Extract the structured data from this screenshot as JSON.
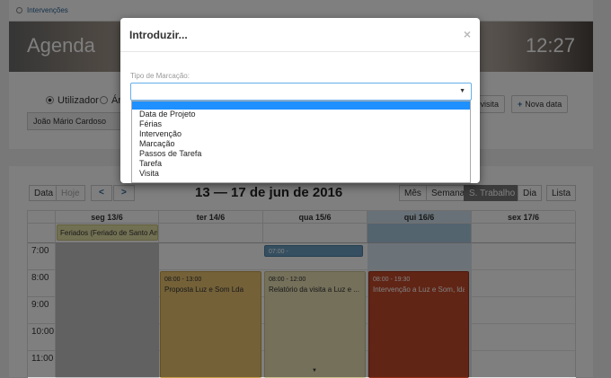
{
  "breadcrumb": {
    "label": "Intervenções"
  },
  "banner": {
    "title": "Agenda",
    "clock": "12:27"
  },
  "filter": {
    "radio_user": "Utilizador",
    "radio_area": "Ár",
    "user_value": "João Mário Cardoso",
    "btn_visita": "a visita",
    "btn_nova_data": "Nova data"
  },
  "toolbar": {
    "data": "Data",
    "hoje": "Hoje",
    "prev": "<",
    "next": ">",
    "range": "13 — 17 de jun de 2016",
    "views": [
      "Mês",
      "Semana",
      "S. Trabalho",
      "Dia",
      "Lista"
    ]
  },
  "calendar": {
    "days": [
      "seg 13/6",
      "ter 14/6",
      "qua 15/6",
      "qui 16/6",
      "sex 17/6"
    ],
    "allday_event": "Feriados (Feriado de Santo An",
    "times": [
      "7:00",
      "8:00",
      "9:00",
      "10:00",
      "11:00"
    ],
    "events": [
      {
        "time": "07:00 -",
        "title": "",
        "color": "#6a9ec3"
      },
      {
        "time": "08:00 - 13:00",
        "title": "Proposta Luz e Som Lda",
        "color": "#e8c270"
      },
      {
        "time": "08:00 - 12:00",
        "title": "Relatório da visita a Luz e ...",
        "color": "#e9e0b4"
      },
      {
        "time": "08:00 - 19:30",
        "title": "Intervenção a Luz e Som, lda",
        "color": "#c24a2a"
      }
    ]
  },
  "modal": {
    "title": "Introduzir...",
    "close": "×",
    "field_label": "Tipo de Marcação:",
    "options": [
      "Data de Projeto",
      "Férias",
      "Intervenção",
      "Marcação",
      "Passos de Tarefa",
      "Tarefa",
      "Visita"
    ]
  }
}
